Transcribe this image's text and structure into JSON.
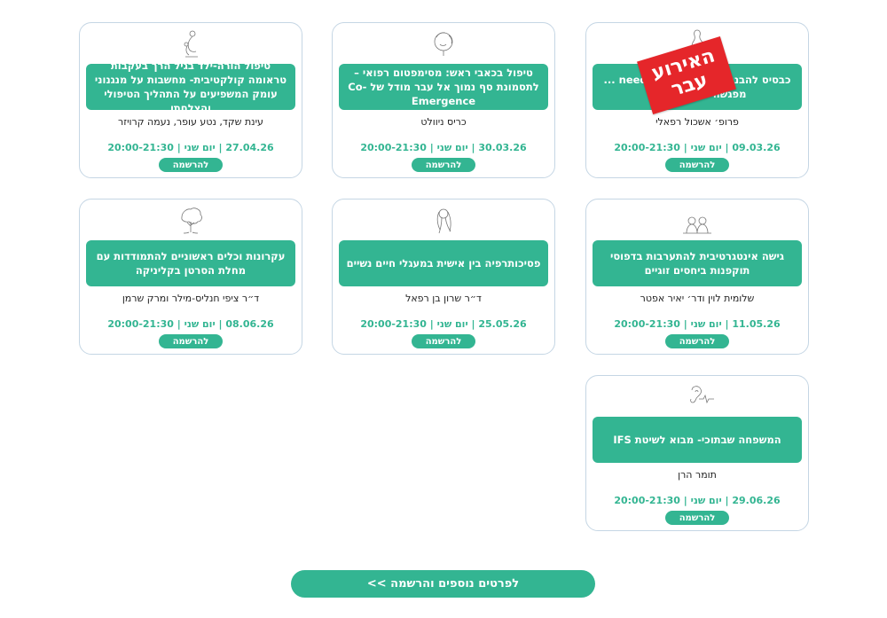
{
  "colors": {
    "accent": "#33b592",
    "border": "#c5d6e4",
    "badge": "#e5262a"
  },
  "events": [
    {
      "title": "כבסיס להבנה ב needs to change ... מפגשה אחת למשנהו",
      "presenter": "פרופ׳ אשכול רפאלי",
      "date": "09.03.26",
      "day": "יום שני",
      "time": "20:00-21:30",
      "register_label": "להרשמה",
      "past_badge": "האירוע עבר",
      "icon": "woman-line-drawing-icon"
    },
    {
      "title": "טיפול בכאבי ראש: מסימפטום רפואי – לתסמונת סף נמוך אל עבר מודל של Co-Emergence",
      "presenter": "כריס ניוולט",
      "date": "30.03.26",
      "day": "יום שני",
      "time": "20:00-21:30",
      "register_label": "להרשמה",
      "icon": "head-line-drawing-icon"
    },
    {
      "title": "טיפול הורה-ילד בגיל הרך בעקבות טראומה קולקטיבית- מחשבות על מנגנוני עומק המשפיעים על התהליך הטיפולי והצלחתו",
      "presenter": "עינת שקד, נטע עופר, נעמה קרויזר",
      "date": "27.04.26",
      "day": "יום שני",
      "time": "20:00-21:30",
      "register_label": "להרשמה",
      "icon": "mother-child-drawing-icon"
    },
    {
      "title": "גישה אינטגרטיבית להתערבות בדפוסי תוקפנות ביחסים זוגיים",
      "presenter": "שלומית לוין ודר׳ יאיר אפטר",
      "date": "11.05.26",
      "day": "יום שני",
      "time": "20:00-21:30",
      "register_label": "להרשמה",
      "icon": "couple-drawing-icon"
    },
    {
      "title": "פסיכותרפיה בין אישית במעגלי חיים נשיים",
      "presenter": "ד״ר שרון בן רפאל",
      "date": "25.05.26",
      "day": "יום שני",
      "time": "20:00-21:30",
      "register_label": "להרשמה",
      "icon": "woman-hair-drawing-icon"
    },
    {
      "title": "עקרונות וכלים ראשוניים להתמודדות עם מחלת הסרטן בקליניקה",
      "presenter": "ד״ר ציפי חנליס-מילר ומרק שרמן",
      "date": "08.06.26",
      "day": "יום שני",
      "time": "20:00-21:30",
      "register_label": "להרשמה",
      "icon": "tree-drawing-icon"
    },
    {
      "title": "המשפחה שבתוכי- מבוא לשיטת IFS",
      "presenter": "תומר הרן",
      "date": "29.06.26",
      "day": "יום שני",
      "time": "20:00-21:30",
      "register_label": "להרשמה",
      "icon": "heartbeat-ear-drawing-icon"
    }
  ],
  "footer": {
    "more_label": "לפרטים נוספים והרשמה  >>"
  }
}
